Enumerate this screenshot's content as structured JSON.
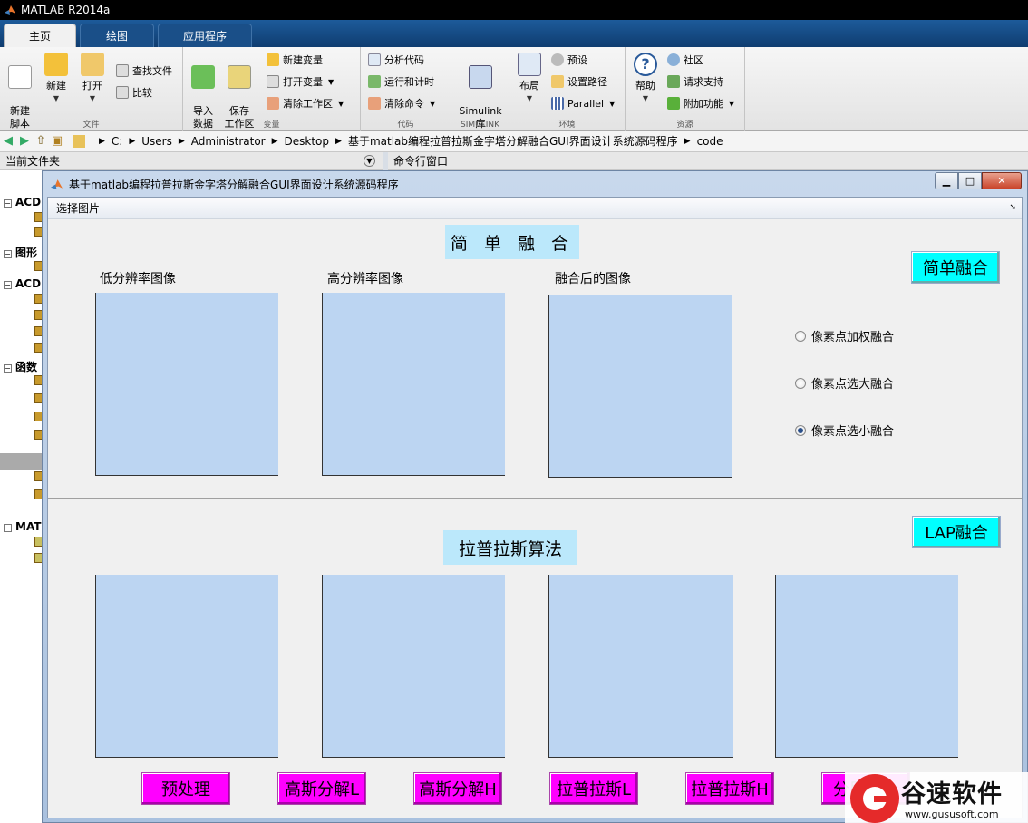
{
  "app": {
    "title": "MATLAB R2014a"
  },
  "tabs": [
    {
      "label": "主页",
      "active": true
    },
    {
      "label": "绘图",
      "active": false
    },
    {
      "label": "应用程序",
      "active": false
    }
  ],
  "ribbon": {
    "file": {
      "label": "文件",
      "new_script": "新建\n脚本",
      "new": "新建",
      "open": "打开",
      "find_files": "查找文件",
      "compare": "比较"
    },
    "variable": {
      "label": "变量",
      "import": "导入\n数据",
      "save": "保存\n工作区",
      "new_var": "新建变量",
      "open_var": "打开变量",
      "clear_ws": "清除工作区"
    },
    "code": {
      "label": "代码",
      "analyze": "分析代码",
      "run_time": "运行和计时",
      "clear_cmd": "清除命令"
    },
    "simulink": {
      "label": "SIMULINK",
      "lib": "Simulink\n库"
    },
    "env": {
      "label": "环境",
      "layout": "布局",
      "prefs": "预设",
      "set_path": "设置路径",
      "parallel": "Parallel"
    },
    "resources": {
      "label": "资源",
      "help": "帮助",
      "community": "社区",
      "support": "请求支持",
      "addons": "附加功能"
    }
  },
  "address": {
    "crumbs": [
      "C:",
      "Users",
      "Administrator",
      "Desktop",
      "基于matlab编程拉普拉斯金字塔分解融合GUI界面设计系统源码程序",
      "code"
    ]
  },
  "panels": {
    "current_folder": "当前文件夹",
    "command_window": "命令行窗口"
  },
  "left_tree": [
    {
      "label": "ACD"
    },
    {
      "label": "图形"
    },
    {
      "label": "ACD"
    },
    {
      "label": "函数"
    },
    {
      "label": "MAT"
    }
  ],
  "figure": {
    "title": "基于matlab编程拉普拉斯金字塔分解融合GUI界面设计系统源码程序",
    "menu": "选择图片",
    "simple_title": "简 单 融 合",
    "lap_title": "拉普拉斯算法",
    "axes_labels": [
      "低分辨率图像",
      "高分辨率图像",
      "融合后的图像"
    ],
    "simple_button": "简单融合",
    "lap_button": "LAP融合",
    "radios": [
      {
        "label": "像素点加权融合",
        "checked": false
      },
      {
        "label": "像素点选大融合",
        "checked": false
      },
      {
        "label": "像素点选小融合",
        "checked": true
      }
    ],
    "buttons": [
      "预处理",
      "高斯分解L",
      "高斯分解H",
      "拉普拉斯L",
      "拉普拉斯H",
      "分层融合"
    ]
  },
  "watermark": {
    "name": "谷速软件",
    "url": "www.gususoft.com"
  },
  "colors": {
    "axes_fill": "#bcd5f2",
    "cyan_button": "#00ffff",
    "magenta_button": "#ff00ff",
    "title_bg": "#bbe8fb"
  }
}
